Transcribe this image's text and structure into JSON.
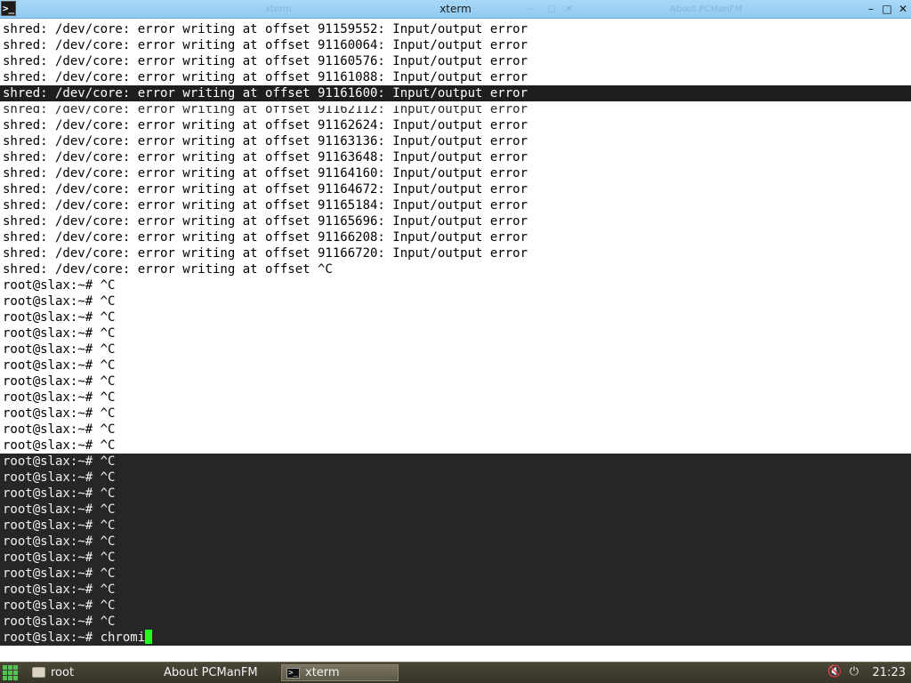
{
  "window": {
    "title": "xterm",
    "ghost_left": "xterm",
    "ghost_right": "About PCManFM",
    "icon_glyph": ">_"
  },
  "terminal": {
    "cursor_color": "#22ff22",
    "lines": [
      "shred: /dev/core: error writing at offset 91159552: Input/output error",
      "shred: /dev/core: error writing at offset 91160064: Input/output error",
      "shred: /dev/core: error writing at offset 91160576: Input/output error",
      "shred: /dev/core: error writing at offset 91161088: Input/output error",
      "shred: /dev/core: error writing at offset 91161600: Input/output error",
      "shred: /dev/core: error writing at offset 91162112: Input/output error",
      "shred: /dev/core: error writing at offset 91162624: Input/output error",
      "shred: /dev/core: error writing at offset 91163136: Input/output error",
      "shred: /dev/core: error writing at offset 91163648: Input/output error",
      "shred: /dev/core: error writing at offset 91164160: Input/output error",
      "shred: /dev/core: error writing at offset 91164672: Input/output error",
      "shred: /dev/core: error writing at offset 91165184: Input/output error",
      "shred: /dev/core: error writing at offset 91165696: Input/output error",
      "shred: /dev/core: error writing at offset 91166208: Input/output error",
      "shred: /dev/core: error writing at offset 91166720: Input/output error",
      "shred: /dev/core: error writing at offset ^C",
      "root@slax:~# ^C",
      "root@slax:~# ^C",
      "root@slax:~# ^C",
      "root@slax:~# ^C",
      "root@slax:~# ^C",
      "root@slax:~# ^C",
      "root@slax:~# ^C",
      "root@slax:~# ^C",
      "root@slax:~# ^C",
      "root@slax:~# ^C",
      "root@slax:~# ^C",
      "root@slax:~# ^C",
      "root@slax:~# ^C",
      "root@slax:~# ^C",
      "root@slax:~# ^C",
      "root@slax:~# ^C",
      "root@slax:~# ^C",
      "root@slax:~# ^C",
      "root@slax:~# ^C",
      "root@slax:~# ^C",
      "root@slax:~# ^C",
      "root@slax:~# ^C"
    ],
    "prompt_line": "root@slax:~# chromi"
  },
  "taskbar": {
    "tasks": [
      {
        "label": "root",
        "icon": "folder-icon"
      },
      {
        "label": "About PCManFM",
        "icon": ""
      },
      {
        "label": "xterm",
        "icon": "terminal-icon"
      }
    ],
    "clock": "21:23"
  }
}
